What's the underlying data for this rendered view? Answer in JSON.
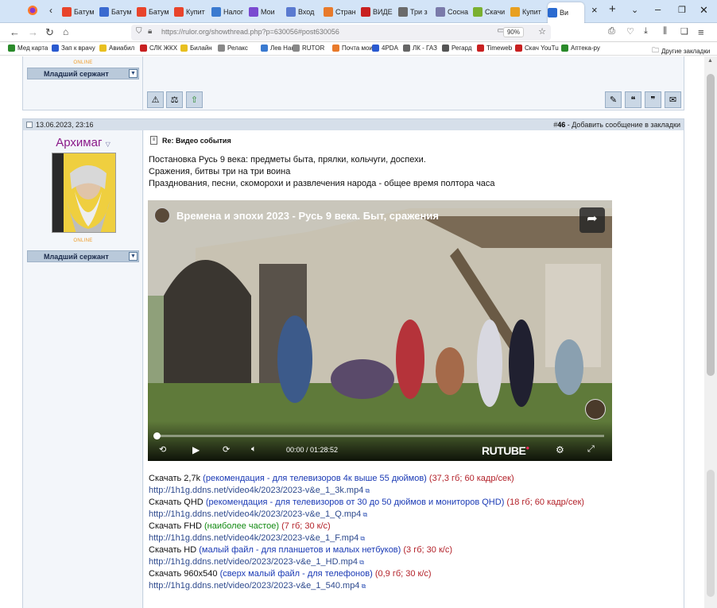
{
  "browser": {
    "tabs": [
      "Батум",
      "Батум",
      "Батум",
      "Купит",
      "Налог",
      "Мои ",
      "Вход",
      "Стран",
      "ВИДЕ",
      "Три з",
      "Сосна",
      "Скачи",
      "Купит",
      "Ви"
    ],
    "url": "https://rulor.org/showthread.php?p=630056#post630056",
    "zoom": "90%"
  },
  "bookmarks": [
    "Мед карта",
    "Зап к врачу",
    "Авиабил",
    "СЛК ЖКХ",
    "Билайн",
    "Релакс",
    "Лев Нанi",
    "RUTOR",
    "Почта мои",
    "4PDA",
    "ЛК - ГАЗ",
    "Регард",
    "Timeweb",
    "Скач YouTu",
    "Аптека-ру"
  ],
  "other_bookmarks": "Другие закладки",
  "post_prev": {
    "online": "ONLINE",
    "rank": "Младший сержант"
  },
  "post": {
    "date": "13.06.2023, 23:16",
    "num_prefix": "#",
    "num": "46",
    "bookmark_text": " - Добавить сообщение в закладки",
    "username": "Архимаг",
    "online": "ONLINE",
    "rank": "Младший сержант",
    "title": "Re: Видео события",
    "line1": "Постановка Русь 9 века: предметы быта, прялки, кольчуги, доспехи.",
    "line2": "Сражения, битвы три на три воина",
    "line3": "Празднования, песни, скоморохи и развлечения народа - общее время полтора часа",
    "video": {
      "title": "Времена и эпохи 2023 - Русь 9 века. Быт, сражения",
      "time": "00:00 / 01:28:52",
      "brand": "RUTUBE",
      "progress": 0
    },
    "downloads": [
      {
        "label": "Скачать 2,7k",
        "note": "(рекомендация - для телевизоров 4к выше 55 дюймов)",
        "note_color": "blue",
        "spec": "(37,3 гб; 60 кадр/сек)",
        "url": "http://1h1g.ddns.net/video4k/2023/2023-v&e_1_3k.mp4"
      },
      {
        "label": "Скачать QHD",
        "note": "(рекомендация - для телевизоров от 30 до 50 дюймов и мониторов QHD)",
        "note_color": "blue",
        "spec": "(18 гб; 60 кадр/сек)",
        "url": "http://1h1g.ddns.net/video4k/2023/2023-v&e_1_Q.mp4"
      },
      {
        "label": "Скачать FHD",
        "note": "(наиболее частое)",
        "note_color": "green",
        "spec": "(7 гб; 30 к/с)",
        "url": "http://1h1g.ddns.net/video4k/2023/2023-v&e_1_F.mp4"
      },
      {
        "label": "Скачать HD",
        "note": "(малый файл - для планшетов и малых нетбуков)",
        "note_color": "blue",
        "spec": "(3 гб; 30 к/с)",
        "url": "http://1h1g.ddns.net/video/2023/2023-v&e_1_HD.mp4"
      },
      {
        "label": "Скачать 960x540",
        "note": "(сверх малый файл - для телефонов)",
        "note_color": "blue",
        "spec": "(0,9 гб; 30 к/с)",
        "url": "http://1h1g.ddns.net/video/2023/2023-v&e_1_540.mp4"
      }
    ]
  }
}
